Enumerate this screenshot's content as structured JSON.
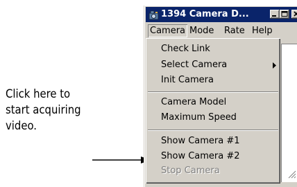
{
  "annotation": {
    "text": "Click here to\nstart acquiring\nvideo."
  },
  "window": {
    "title": "1394 Camera D...",
    "icon": "camera-app-icon"
  },
  "menubar": {
    "items": [
      "Camera",
      "Mode",
      "Rate",
      "Help"
    ]
  },
  "camera_menu": {
    "items": [
      {
        "label": "Check Link",
        "enabled": true
      },
      {
        "label": "Select Camera",
        "enabled": true,
        "submenu": true
      },
      {
        "label": "Init Camera",
        "enabled": true
      },
      {
        "label": "Camera Model",
        "enabled": true
      },
      {
        "label": "Maximum Speed",
        "enabled": true
      },
      {
        "label": "Show Camera #1",
        "enabled": true
      },
      {
        "label": "Show Camera #2",
        "enabled": true
      },
      {
        "label": "Stop Camera",
        "enabled": false
      }
    ]
  },
  "colors": {
    "titlebar": "#0a246a",
    "face": "#d4d0c8",
    "disabled_text": "#808080"
  }
}
